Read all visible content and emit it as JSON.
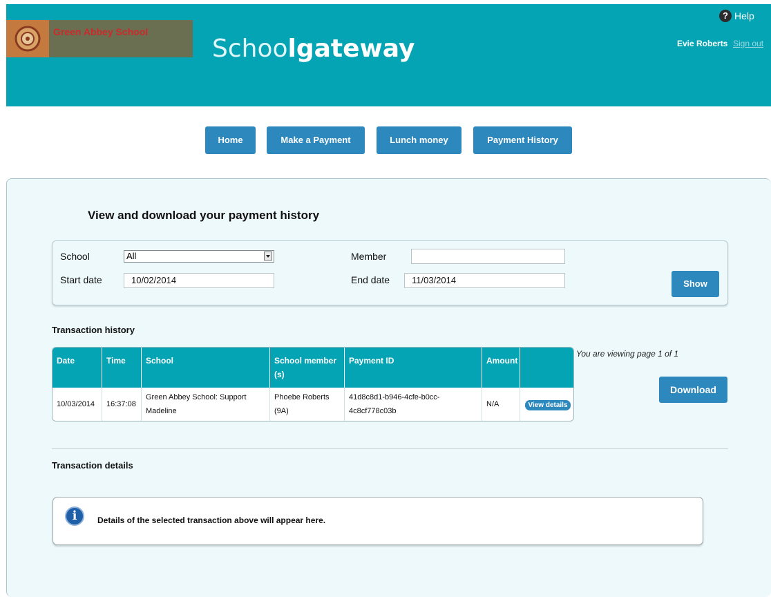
{
  "header": {
    "school_name": "Green Abbey School",
    "brand_thin": "Schoo",
    "brand_bold": "lgateway",
    "help_label": "Help",
    "user_name": "Evie Roberts",
    "sign_out_label": "Sign out"
  },
  "nav": {
    "home": "Home",
    "make_payment": "Make a Payment",
    "lunch_money": "Lunch money",
    "payment_history": "Payment History"
  },
  "page": {
    "title": "View and download your payment history"
  },
  "filters": {
    "school_label": "School",
    "school_value": "All",
    "member_label": "Member",
    "member_value": "",
    "start_date_label": "Start date",
    "start_date_value": "10/02/2014",
    "end_date_label": "End date",
    "end_date_value": "11/03/2014",
    "show_label": "Show"
  },
  "transactions": {
    "heading": "Transaction history",
    "columns": [
      "Date",
      "Time",
      "School",
      "School member (s)",
      "Payment ID",
      "Amount"
    ],
    "rows": [
      {
        "date": "10/03/2014",
        "time": "16:37:08",
        "school": "Green Abbey School: Support Madeline",
        "member": "Phoebe Roberts (9A)",
        "payment_id": "41d8c8d1-b946-4cfe-b0cc-4c8cf778c03b",
        "amount": "N/A",
        "action": "View details"
      }
    ],
    "page_info": "You are viewing page 1 of 1",
    "download_label": "Download"
  },
  "details": {
    "heading": "Transaction details",
    "message": "Details of the selected transaction above will appear here."
  },
  "colors": {
    "header_bg": "#05a4b5",
    "button_bg": "#2d88bd",
    "panel_bg": "#eef9fb"
  }
}
